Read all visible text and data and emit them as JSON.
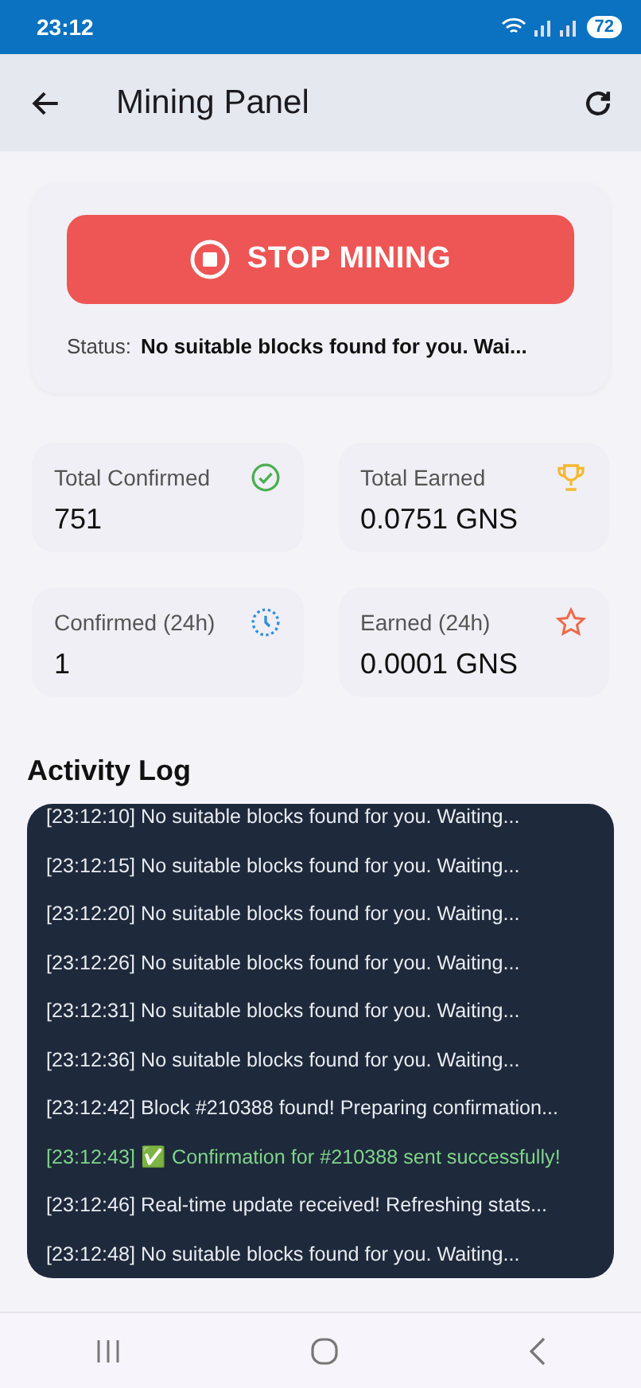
{
  "status_bar": {
    "time": "23:12",
    "battery": "72"
  },
  "app_bar": {
    "title": "Mining Panel"
  },
  "control": {
    "button": "STOP MINING",
    "status_label": "Status:",
    "status_text": "No suitable blocks found for you. Wai..."
  },
  "stats": [
    {
      "label": "Total Confirmed",
      "value": "751",
      "kind": "check",
      "color": "#4caf50"
    },
    {
      "label": "Total Earned",
      "value": "0.0751 GNS",
      "kind": "trophy",
      "color": "#f5b82e"
    },
    {
      "label": "Confirmed (24h)",
      "value": "1",
      "kind": "clock",
      "color": "#2f8fe0"
    },
    {
      "label": "Earned (24h)",
      "value": "0.0001 GNS",
      "kind": "star",
      "color": "#ee6a4a"
    }
  ],
  "activity_log": {
    "title": "Activity Log",
    "entries": [
      {
        "text": "[23:12:10] No suitable blocks found for you. Waiting...",
        "kind": "info"
      },
      {
        "text": "[23:12:15] No suitable blocks found for you. Waiting...",
        "kind": "info"
      },
      {
        "text": "[23:12:20] No suitable blocks found for you. Waiting...",
        "kind": "info"
      },
      {
        "text": "[23:12:26] No suitable blocks found for you. Waiting...",
        "kind": "info"
      },
      {
        "text": "[23:12:31] No suitable blocks found for you. Waiting...",
        "kind": "info"
      },
      {
        "text": "[23:12:36] No suitable blocks found for you. Waiting...",
        "kind": "info"
      },
      {
        "text": "[23:12:42] Block #210388 found! Preparing confirmation...",
        "kind": "info"
      },
      {
        "text": "[23:12:43] ✅ Confirmation for #210388 sent successfully!",
        "kind": "success"
      },
      {
        "text": "[23:12:46] Real-time update received! Refreshing stats...",
        "kind": "info"
      },
      {
        "text": "[23:12:48] No suitable blocks found for you. Waiting...",
        "kind": "info"
      }
    ]
  }
}
